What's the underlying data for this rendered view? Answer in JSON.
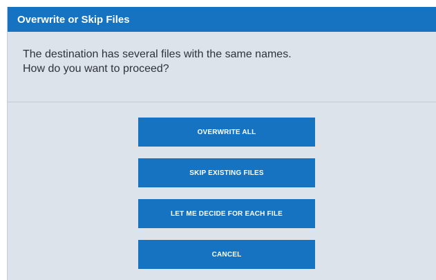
{
  "dialog": {
    "title": "Overwrite or Skip Files",
    "message_line1": "The destination has several files with the same names.",
    "message_line2": "How do you want to proceed?",
    "buttons": {
      "overwrite_all": "OVERWRITE ALL",
      "skip_existing": "SKIP EXISTING FILES",
      "decide_each": "LET ME DECIDE FOR EACH FILE",
      "cancel": "CANCEL"
    }
  },
  "colors": {
    "accent": "#1573c1",
    "background": "#dde3ea",
    "text": "#2e3338"
  }
}
